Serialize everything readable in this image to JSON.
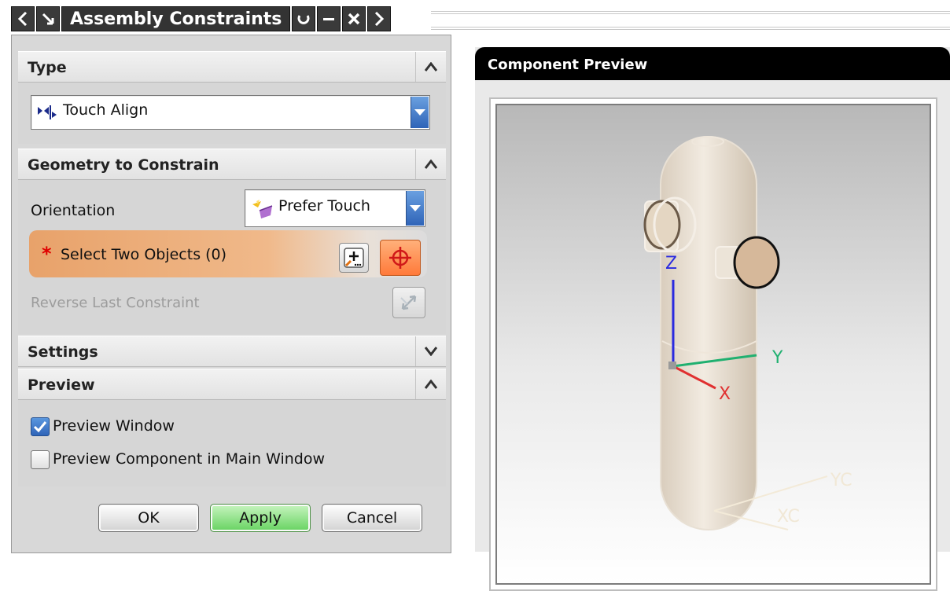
{
  "window": {
    "title": "Assembly Constraints",
    "icons": [
      "back-arrow-icon",
      "select-arrow-icon",
      "reset-icon",
      "minimize-icon",
      "close-icon",
      "forward-arrow-icon"
    ]
  },
  "sections": {
    "type": {
      "header": "Type",
      "selected": "Touch Align"
    },
    "geometry": {
      "header": "Geometry to Constrain",
      "orientation_label": "Orientation",
      "orientation_value": "Prefer Touch",
      "select_objects": "Select Two Objects (0)",
      "reverse_label": "Reverse Last Constraint"
    },
    "settings": {
      "header": "Settings"
    },
    "preview": {
      "header": "Preview",
      "options": [
        {
          "label": "Preview Window",
          "checked": true
        },
        {
          "label": "Preview Component in Main Window",
          "checked": false
        }
      ]
    }
  },
  "buttons": {
    "ok": "OK",
    "apply": "Apply",
    "cancel": "Cancel"
  },
  "component_preview": {
    "title": "Component Preview",
    "axes": {
      "z": "Z",
      "y": "Y",
      "x": "X",
      "yc": "YC",
      "xc": "XC"
    }
  },
  "colors": {
    "accent_blue": "#2f64b8",
    "select_orange": "#e8a26a",
    "apply_green": "#66d260",
    "axis_x": "#e03030",
    "axis_y": "#20b070",
    "axis_z": "#2a2ae0"
  }
}
